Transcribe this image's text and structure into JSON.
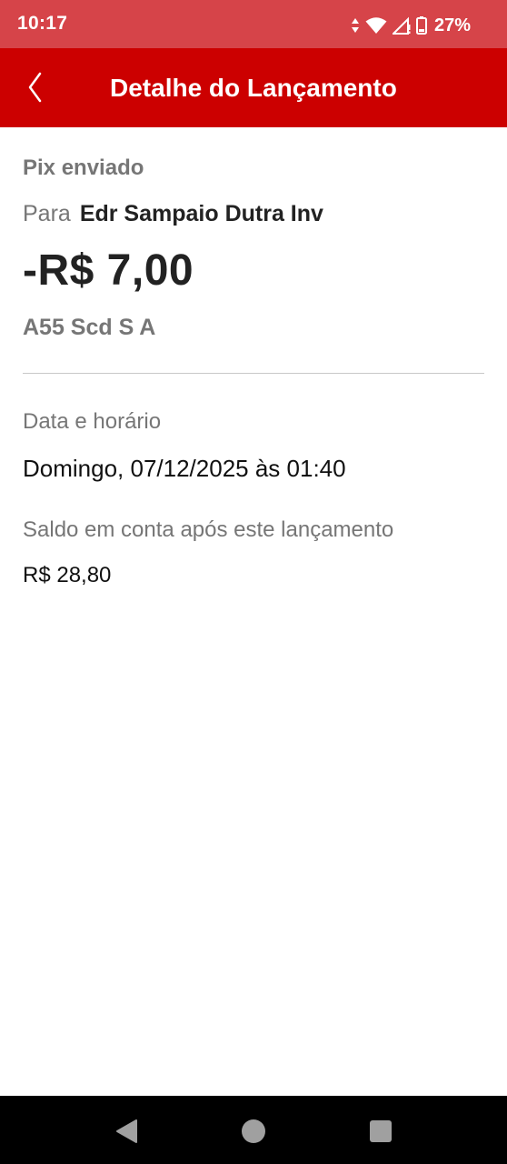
{
  "status_bar": {
    "time": "10:17",
    "battery": "27%",
    "icons": [
      "data-arrows-icon",
      "wifi-icon",
      "signal-icon",
      "battery-icon"
    ]
  },
  "header": {
    "title": "Detalhe do Lançamento",
    "back_icon": "chevron-left-icon",
    "background_color": "#cc0000"
  },
  "transaction": {
    "type": "Pix enviado",
    "recipient_prefix": "Para",
    "recipient_name": "Edr Sampaio Dutra Inv",
    "amount": "-R$ 7,00",
    "institution": "A55 Scd S A"
  },
  "details": {
    "datetime_label": "Data e horário",
    "datetime_value": "Domingo, 07/12/2025 às 01:40",
    "balance_label": "Saldo em conta após este lançamento",
    "balance_value": "R$ 28,80"
  },
  "nav_bar": {
    "icons": [
      "nav-back-icon",
      "nav-home-icon",
      "nav-recents-icon"
    ]
  }
}
